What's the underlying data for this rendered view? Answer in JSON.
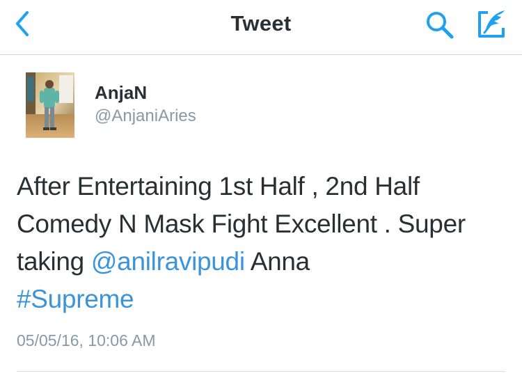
{
  "navbar": {
    "title": "Tweet",
    "back_icon": "chevron-left-icon",
    "search_icon": "search-icon",
    "compose_icon": "compose-feather-icon",
    "accent_color": "#1da1f2"
  },
  "author": {
    "display_name": "AnjaN",
    "handle": "@AnjaniAries"
  },
  "tweet": {
    "line1": "After Entertaining 1st Half , 2nd Half",
    "line2": "Comedy N Mask Fight Excellent . Super",
    "line3_prefix": "taking ",
    "mention": "@anilravipudi",
    "line3_suffix": " Anna",
    "hashtag": "#Supreme",
    "timestamp": "05/05/16, 10:06 AM",
    "link_color": "#3b94d9"
  }
}
